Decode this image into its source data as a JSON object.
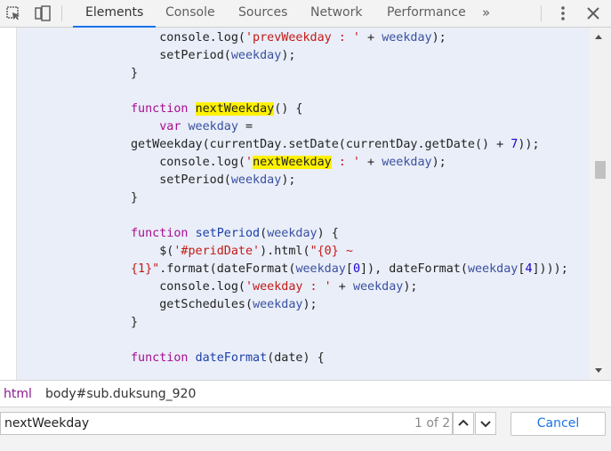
{
  "toolbar": {
    "icons": [
      "inspect-icon",
      "device-toggle-icon",
      "more-options-icon",
      "close-icon"
    ],
    "tabs": [
      {
        "label": "Elements",
        "active": true
      },
      {
        "label": "Console",
        "active": false
      },
      {
        "label": "Sources",
        "active": false
      },
      {
        "label": "Network",
        "active": false
      },
      {
        "label": "Performance",
        "active": false
      }
    ],
    "more_tabs_label": "»"
  },
  "code": {
    "lines": [
      [
        {
          "t": "    console.log(",
          "c": ""
        },
        {
          "t": "'prevWeekday : '",
          "c": "str"
        },
        {
          "t": " + ",
          "c": ""
        },
        {
          "t": "weekday",
          "c": "var"
        },
        {
          "t": ");",
          "c": ""
        }
      ],
      [
        {
          "t": "    setPeriod(",
          "c": ""
        },
        {
          "t": "weekday",
          "c": "var"
        },
        {
          "t": ");",
          "c": ""
        }
      ],
      [
        {
          "t": "}",
          "c": ""
        }
      ],
      [
        {
          "t": "",
          "c": ""
        }
      ],
      [
        {
          "t": "function",
          "c": "kw"
        },
        {
          "t": " ",
          "c": ""
        },
        {
          "t": "nextWeekday",
          "c": "hl"
        },
        {
          "t": "() {",
          "c": ""
        }
      ],
      [
        {
          "t": "    ",
          "c": ""
        },
        {
          "t": "var",
          "c": "kw"
        },
        {
          "t": " ",
          "c": ""
        },
        {
          "t": "weekday",
          "c": "var"
        },
        {
          "t": " =",
          "c": ""
        }
      ],
      [
        {
          "t": "getWeekday(currentDay.setDate(currentDay.getDate() + ",
          "c": ""
        },
        {
          "t": "7",
          "c": "num"
        },
        {
          "t": "));",
          "c": ""
        }
      ],
      [
        {
          "t": "    console.log(",
          "c": ""
        },
        {
          "t": "'",
          "c": "str"
        },
        {
          "t": "nextWeekday",
          "c": "hl"
        },
        {
          "t": " : '",
          "c": "str"
        },
        {
          "t": " + ",
          "c": ""
        },
        {
          "t": "weekday",
          "c": "var"
        },
        {
          "t": ");",
          "c": ""
        }
      ],
      [
        {
          "t": "    setPeriod(",
          "c": ""
        },
        {
          "t": "weekday",
          "c": "var"
        },
        {
          "t": ");",
          "c": ""
        }
      ],
      [
        {
          "t": "}",
          "c": ""
        }
      ],
      [
        {
          "t": "",
          "c": ""
        }
      ],
      [
        {
          "t": "function",
          "c": "kw"
        },
        {
          "t": " ",
          "c": ""
        },
        {
          "t": "setPeriod",
          "c": "fn"
        },
        {
          "t": "(",
          "c": ""
        },
        {
          "t": "weekday",
          "c": "var"
        },
        {
          "t": ") {",
          "c": ""
        }
      ],
      [
        {
          "t": "    $(",
          "c": ""
        },
        {
          "t": "'#peridDate'",
          "c": "str"
        },
        {
          "t": ").html(",
          "c": ""
        },
        {
          "t": "\"{0} ~",
          "c": "str"
        }
      ],
      [
        {
          "t": "{1}\"",
          "c": "str"
        },
        {
          "t": ".format(dateFormat(",
          "c": ""
        },
        {
          "t": "weekday",
          "c": "var"
        },
        {
          "t": "[",
          "c": ""
        },
        {
          "t": "0",
          "c": "num"
        },
        {
          "t": "]), dateFormat(",
          "c": ""
        },
        {
          "t": "weekday",
          "c": "var"
        },
        {
          "t": "[",
          "c": ""
        },
        {
          "t": "4",
          "c": "num"
        },
        {
          "t": "])));",
          "c": ""
        }
      ],
      [
        {
          "t": "    console.log(",
          "c": ""
        },
        {
          "t": "'weekday : '",
          "c": "str"
        },
        {
          "t": " + ",
          "c": ""
        },
        {
          "t": "weekday",
          "c": "var"
        },
        {
          "t": ");",
          "c": ""
        }
      ],
      [
        {
          "t": "    getSchedules(",
          "c": ""
        },
        {
          "t": "weekday",
          "c": "var"
        },
        {
          "t": ");",
          "c": ""
        }
      ],
      [
        {
          "t": "}",
          "c": ""
        }
      ],
      [
        {
          "t": "",
          "c": ""
        }
      ],
      [
        {
          "t": "function",
          "c": "kw"
        },
        {
          "t": " ",
          "c": ""
        },
        {
          "t": "dateFormat",
          "c": "fn"
        },
        {
          "t": "(date) {",
          "c": ""
        }
      ]
    ]
  },
  "breadcrumb": {
    "items": [
      "html",
      "body#sub.duksung_920"
    ]
  },
  "search": {
    "value": "nextWeekday",
    "match_count": "1 of 2",
    "prev_icon": "chevron-up-icon",
    "next_icon": "chevron-down-icon",
    "cancel_label": "Cancel"
  },
  "colors": {
    "accent": "#1a73e8",
    "highlight": "#fff200",
    "code_background": "#e9eef8"
  }
}
